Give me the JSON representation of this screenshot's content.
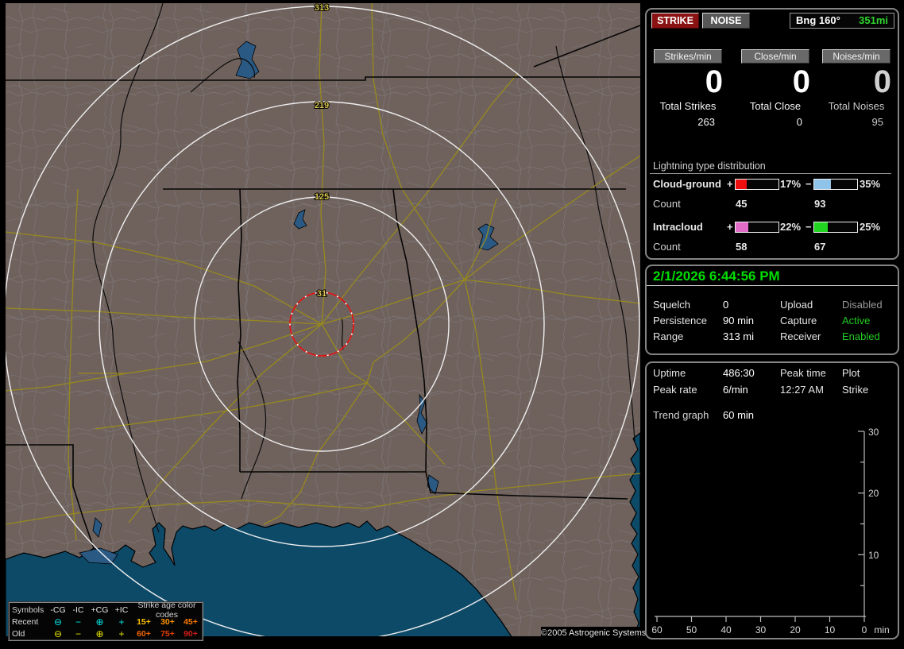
{
  "map": {
    "ring_labels": {
      "outer": "313",
      "third": "219",
      "second": "125",
      "inner": "31"
    },
    "ring_color": "#eeeeee",
    "alarm_ring_color": "#dd1111",
    "label_color": "#dcc84e",
    "land_color": "#6f625d",
    "water_color": "#0d4a68",
    "road_color": "#97891c",
    "legend": {
      "symbols_header": "Symbols",
      "columns": [
        "-CG",
        "-IC",
        "+CG",
        "+IC"
      ],
      "age_header": "Strike age color codes",
      "glyphs": {
        "cg_neg": "⊖",
        "ic_neg": "−",
        "cg_pos": "⊕",
        "ic_pos": "+"
      },
      "rows": [
        {
          "label": "Recent",
          "color": "#00e8e8",
          "ages": [
            "15+",
            "30+",
            "45+"
          ],
          "age_colors": [
            "#ffc000",
            "#ff9400",
            "#ff7a00"
          ]
        },
        {
          "label": "Old",
          "color": "#e8e800",
          "ages": [
            "60+",
            "75+",
            "90+"
          ],
          "age_colors": [
            "#f06400",
            "#e63c00",
            "#d21e14"
          ]
        }
      ]
    },
    "copyright": "©2005 Astrogenic Systems"
  },
  "stats": {
    "strike_btn": "STRIKE",
    "noise_btn": "NOISE",
    "bearing_label": "Bng 160°",
    "bearing_value": "351mi",
    "bearing_color": "#2fd42f",
    "counters": [
      {
        "chip": "Strikes/min",
        "rate": "0",
        "rate_color": "#ffffff",
        "total_label": "Total Strikes",
        "total": "263",
        "col_color": "#f4f4f4"
      },
      {
        "chip": "Close/min",
        "rate": "0",
        "rate_color": "#ffffff",
        "total_label": "Total Close",
        "total": "0",
        "col_color": "#f4f4f4"
      },
      {
        "chip": "Noises/min",
        "rate": "0",
        "rate_color": "#cfcfcf",
        "total_label": "Total Noises",
        "total": "95",
        "col_color": "#c8c8c8"
      }
    ],
    "distribution": {
      "title": "Lightning type distribution",
      "count_label": "Count",
      "rows": [
        {
          "name": "Cloud-ground",
          "plus_sign": "+",
          "minus_sign": "−",
          "plus_pct": "17%",
          "plus_fill": "25%",
          "plus_color": "#ee1010",
          "plus_count": "45",
          "minus_pct": "35%",
          "minus_fill": "38%",
          "minus_color": "#8fc3ea",
          "minus_count": "93"
        },
        {
          "name": "Intracloud",
          "plus_sign": "+",
          "minus_sign": "−",
          "plus_pct": "22%",
          "plus_fill": "30%",
          "plus_color": "#e06cc8",
          "plus_count": "58",
          "minus_pct": "25%",
          "minus_fill": "32%",
          "minus_color": "#21d421",
          "minus_count": "67"
        }
      ]
    }
  },
  "status": {
    "datetime": "2/1/2026 6:44:56 PM",
    "datetime_color": "#00dd00",
    "rows": [
      {
        "l1": "Squelch",
        "v1": "0",
        "l2": "Upload",
        "v2": "Disabled",
        "v2_color": "#9a9a9a"
      },
      {
        "l1": "Persistence",
        "v1": "90 min",
        "l2": "Capture",
        "v2": "Active",
        "v2_color": "#22cc22"
      },
      {
        "l1": "Range",
        "v1": "313 mi",
        "l2": "Receiver",
        "v2": "Enabled",
        "v2_color": "#22cc22"
      }
    ]
  },
  "session": {
    "rows": [
      {
        "l1": "Uptime",
        "v1": "486:30",
        "l2": "Peak time",
        "v2": "Plot"
      },
      {
        "l1": "Peak rate",
        "v1": "6/min",
        "l2": "12:27 AM",
        "v2": "Strike"
      }
    ],
    "trend_label": "Trend graph",
    "trend_value": "60 min"
  },
  "chart_data": {
    "type": "line",
    "title": "Strike rate trend graph (last 60 min)",
    "x_ticks": [
      "60",
      "50",
      "40",
      "30",
      "20",
      "10",
      "0"
    ],
    "x_unit": "min",
    "y_ticks": [
      "30",
      "20",
      "10"
    ],
    "ylim": [
      0,
      30
    ],
    "xlim_minutes_ago": [
      60,
      0
    ],
    "series": [
      {
        "name": "Strike",
        "values": []
      }
    ],
    "note": "axes shown, no trend line plotted"
  }
}
